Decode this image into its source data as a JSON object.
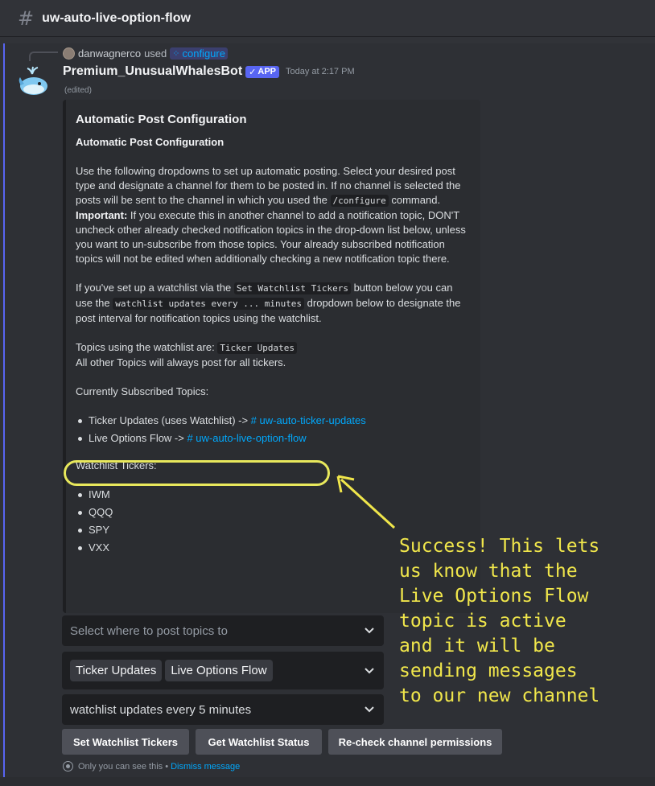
{
  "channel": {
    "title": "uw-auto-live-option-flow"
  },
  "reply": {
    "user": "danwagnerco",
    "used": "used",
    "command": "configure"
  },
  "message": {
    "bot_name": "Premium_UnusualWhalesBot",
    "badge": "APP",
    "timestamp": "Today at 2:17 PM",
    "edited": "(edited)"
  },
  "embed": {
    "title": "Automatic Post Configuration",
    "subtitle": "Automatic Post Configuration",
    "p1_a": "Use the following dropdowns to set up automatic posting. Select your desired post type and designate a channel for them to be posted in. If no channel is selected the posts will be sent to the channel in which you used the ",
    "p1_code": "/configure",
    "p1_b": " command.",
    "important_label": "Important:",
    "important_text": " If you execute this in another channel to add a notification topic, DON'T uncheck other already checked notification topics in the drop-down list below, unless you want to un-subscribe from those topics. Your already subscribed notification topics will not be edited when additionally checking a new notification topic there.",
    "p2_a": "If you've set up a watchlist via the ",
    "p2_code1": "Set Watchlist Tickers",
    "p2_b": " button below you can use the ",
    "p2_code2": "watchlist updates every ... minutes",
    "p2_c": " dropdown below to designate the post interval for notification topics using the watchlist.",
    "p3_a": "Topics using the watchlist are: ",
    "p3_code": "Ticker Updates",
    "p3_b": "All other Topics will always post for all tickers.",
    "subscribed_label": "Currently Subscribed Topics:",
    "topics": [
      {
        "text": "Ticker Updates (uses Watchlist) -> ",
        "link": "# uw-auto-ticker-updates"
      },
      {
        "text": "Live Options Flow -> ",
        "link": "# uw-auto-live-option-flow"
      }
    ],
    "watchlist_label": "Watchlist Tickers:",
    "tickers": [
      "IWM",
      "QQQ",
      "SPY",
      "VXX"
    ]
  },
  "controls": {
    "channel_select_placeholder": "Select where to post topics to",
    "topic_chips": [
      "Ticker Updates",
      "Live Options Flow"
    ],
    "interval_select": "watchlist updates every 5 minutes",
    "buttons": [
      "Set Watchlist Tickers",
      "Get Watchlist Status",
      "Re-check channel permissions"
    ]
  },
  "ephemeral": {
    "text": "Only you can see this • ",
    "dismiss": "Dismiss message"
  },
  "annotation": {
    "lines": [
      "Success! This lets",
      "us know that the",
      "Live Options Flow",
      "topic is active",
      "and it will be",
      "sending messages",
      "to our new channel"
    ]
  },
  "colors": {
    "accent": "#5865f2",
    "link": "#00a8fc",
    "annotation": "#f0e64b"
  }
}
